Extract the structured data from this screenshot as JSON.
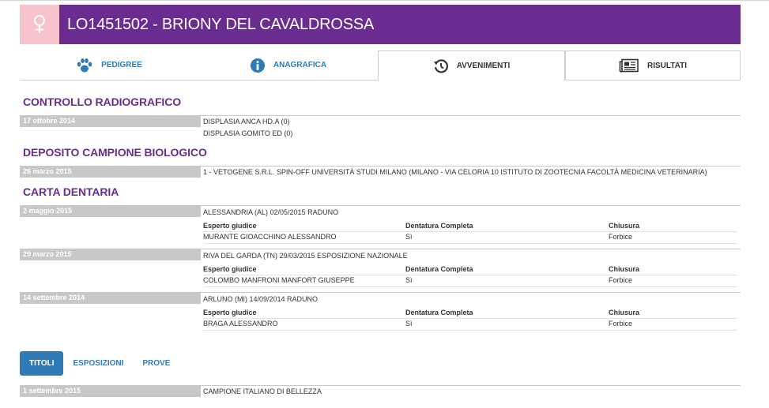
{
  "header": {
    "sex_icon": "female-icon",
    "sex_color": "#f7c4cb",
    "title_color": "#6b2c91",
    "title": "LO1451502 - BRIONY DEL CAVALDROSSA"
  },
  "tabs": [
    {
      "label": "PEDIGREE",
      "icon": "paw-icon"
    },
    {
      "label": "ANAGRAFICA",
      "icon": "info-icon"
    },
    {
      "label": "AVVENIMENTI",
      "icon": "history-icon"
    },
    {
      "label": "RISULTATI",
      "icon": "newspaper-icon"
    }
  ],
  "controllo": {
    "title": "CONTROLLO RADIOGRAFICO",
    "date": "17 ottobre 2014",
    "lines": [
      "DISPLASIA ANCA HD.A (0)",
      "DISPLASIA GOMITO ED (0)"
    ]
  },
  "deposito": {
    "title": "DEPOSITO CAMPIONE BIOLOGICO",
    "date": "26 marzo 2015",
    "text": "1 - VETOGENE S.R.L. SPIN-OFF UNIVERSITÀ STUDI MILANO (MILANO - VIA CELORIA 10 ISTITUTO DI ZOOTECNIA FACOLTÀ MEDICINA VETERINARIA)"
  },
  "carta": {
    "title": "CARTA DENTARIA",
    "headers": {
      "esperto": "Esperto giudice",
      "dentatura": "Dentatura Completa",
      "chiusura": "Chiusura"
    },
    "entries": [
      {
        "date": "2 maggio 2015",
        "event": "ALESSANDRIA (AL) 02/05/2015 RADUNO",
        "esperto": "MURANTE GIOACCHINO ALESSANDRO",
        "dentatura": "Sì",
        "chiusura": "Forbice"
      },
      {
        "date": "29 marzo 2015",
        "event": "RIVA DEL GARDA (TN) 29/03/2015 ESPOSIZIONE NAZIONALE",
        "esperto": "COLOMBO MANFRONI MANFORT GIUSEPPE",
        "dentatura": "Sì",
        "chiusura": "Forbice"
      },
      {
        "date": "14 settembre 2014",
        "event": "ARLUNO (MI) 14/09/2014 RADUNO",
        "esperto": "BRAGA ALESSANDRO",
        "dentatura": "Sì",
        "chiusura": "Forbice"
      }
    ]
  },
  "subtabs": [
    {
      "label": "TITOLI",
      "active": true
    },
    {
      "label": "ESPOSIZIONI",
      "active": false
    },
    {
      "label": "PROVE",
      "active": false
    }
  ],
  "titoli": {
    "date": "1 settembre 2015",
    "text": "CAMPIONE ITALIANO DI BELLEZZA"
  }
}
